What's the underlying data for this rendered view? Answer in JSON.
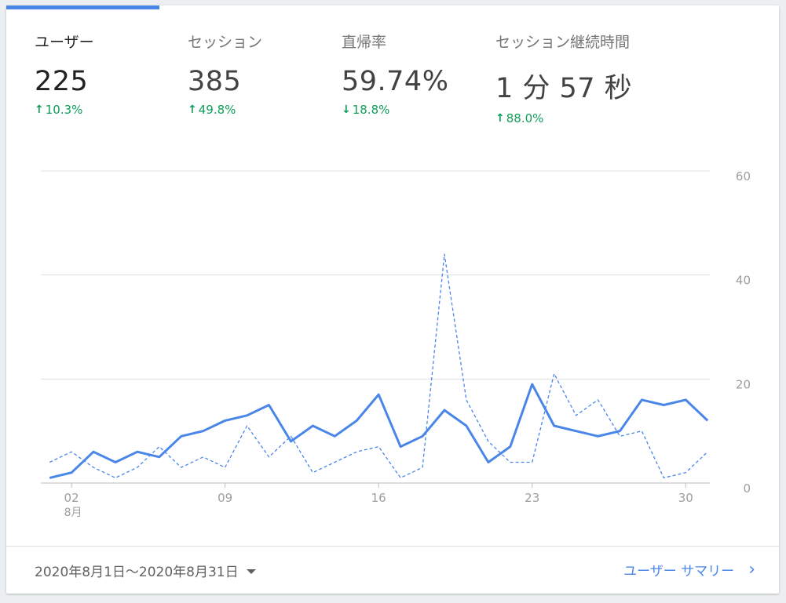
{
  "metrics": [
    {
      "label": "ユーザー",
      "value": "225",
      "delta": "10.3%",
      "direction": "up",
      "active": true
    },
    {
      "label": "セッション",
      "value": "385",
      "delta": "49.8%",
      "direction": "up",
      "active": false
    },
    {
      "label": "直帰率",
      "value": "59.74%",
      "delta": "18.8%",
      "direction": "down",
      "active": false
    },
    {
      "label": "セッション継続時間",
      "value": "1 分 57 秒",
      "delta": "88.0%",
      "direction": "up",
      "active": false
    }
  ],
  "colors": {
    "accent": "#4a86e8",
    "positive": "#0f9d58",
    "grid": "#e0e0e0",
    "axis_text": "#9e9e9e"
  },
  "chart_data": {
    "type": "line",
    "x": [
      1,
      2,
      3,
      4,
      5,
      6,
      7,
      8,
      9,
      10,
      11,
      12,
      13,
      14,
      15,
      16,
      17,
      18,
      19,
      20,
      21,
      22,
      23,
      24,
      25,
      26,
      27,
      28,
      29,
      30,
      31
    ],
    "series": [
      {
        "style": "solid",
        "values": [
          1,
          2,
          6,
          4,
          6,
          5,
          9,
          10,
          12,
          13,
          15,
          8,
          11,
          9,
          12,
          17,
          7,
          9,
          14,
          11,
          4,
          7,
          19,
          11,
          10,
          9,
          10,
          16,
          15,
          16,
          12
        ]
      },
      {
        "style": "dashed",
        "values": [
          4,
          6,
          3,
          1,
          3,
          7,
          3,
          5,
          3,
          11,
          5,
          9,
          2,
          4,
          6,
          7,
          1,
          3,
          44,
          16,
          8,
          4,
          4,
          21,
          13,
          16,
          9,
          10,
          1,
          2,
          6
        ]
      }
    ],
    "ylim": [
      0,
      60
    ],
    "y_ticks": [
      "0",
      "20",
      "40",
      "60"
    ],
    "x_ticks": [
      {
        "day": 2,
        "label": "02",
        "sub": "8月"
      },
      {
        "day": 9,
        "label": "09",
        "sub": ""
      },
      {
        "day": 16,
        "label": "16",
        "sub": ""
      },
      {
        "day": 23,
        "label": "23",
        "sub": ""
      },
      {
        "day": 30,
        "label": "30",
        "sub": ""
      }
    ],
    "grid": true
  },
  "footer": {
    "date_range": "2020年8月1日～2020年8月31日",
    "summary_link": "ユーザー サマリー",
    "chevron": "chevron-right-icon",
    "caret": "caret-down-icon"
  }
}
